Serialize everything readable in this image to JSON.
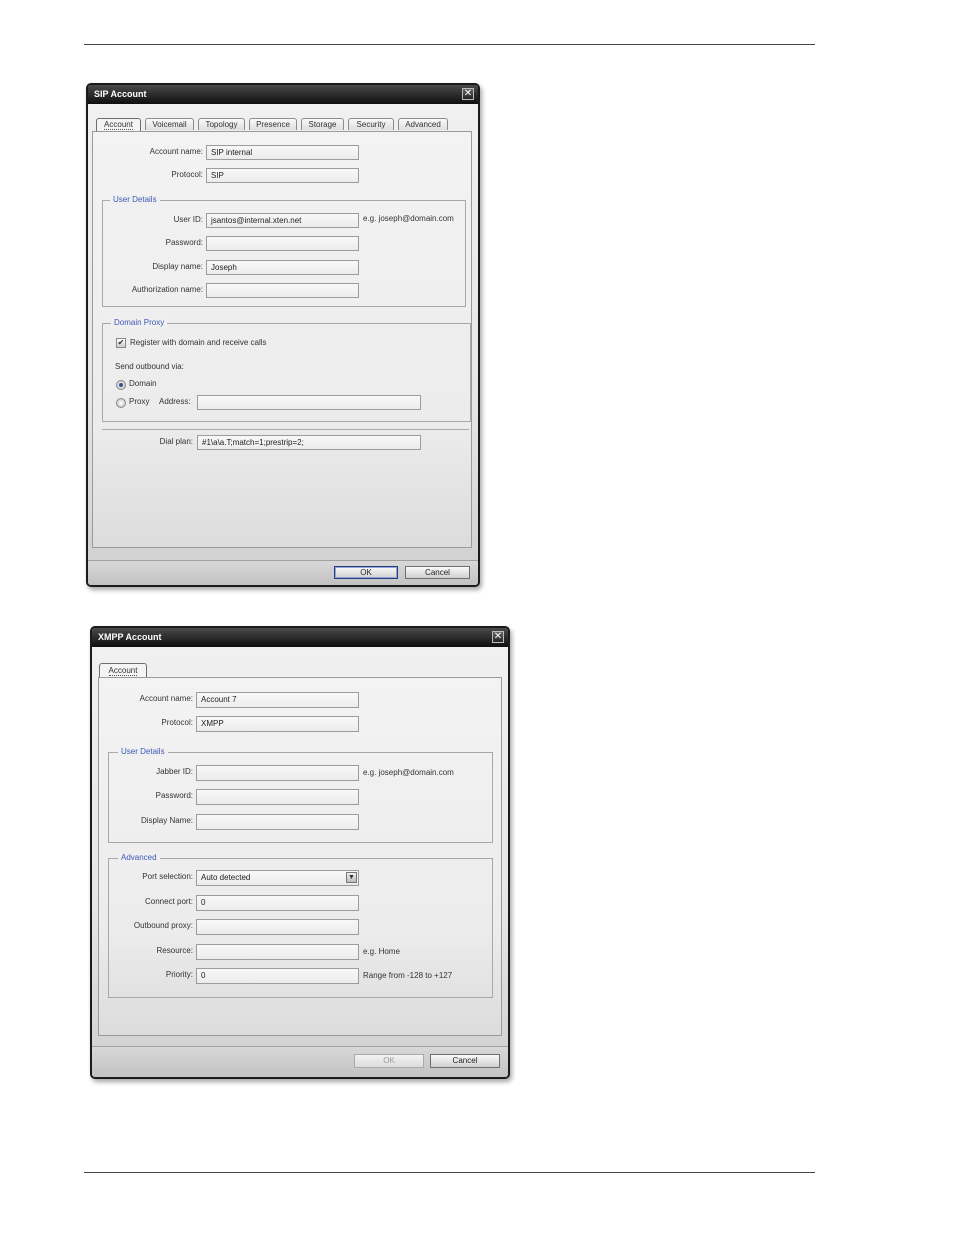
{
  "sip": {
    "title": "SIP Account",
    "close": "✕",
    "tabs": [
      "Account",
      "Voicemail",
      "Topology",
      "Presence",
      "Storage",
      "Security",
      "Advanced"
    ],
    "account_name_label": "Account name:",
    "account_name_value": "SIP internal",
    "protocol_label": "Protocol:",
    "protocol_value": "SIP",
    "user_details": {
      "legend": "User Details",
      "user_id_label": "User ID:",
      "user_id_value": "jsantos@internal.xten.net",
      "user_id_hint": "e.g. joseph@domain.com",
      "password_label": "Password:",
      "password_value": "",
      "display_name_label": "Display name:",
      "display_name_value": "Joseph",
      "auth_name_label": "Authorization name:",
      "auth_name_value": ""
    },
    "domain_proxy": {
      "legend": "Domain Proxy",
      "register_label": "Register with domain and receive calls",
      "register_checked": true,
      "send_via_label": "Send outbound via:",
      "domain_label": "Domain",
      "proxy_label": "Proxy",
      "address_label": "Address:",
      "address_value": ""
    },
    "dial_plan_label": "Dial plan:",
    "dial_plan_value": "#1\\a\\a.T;match=1;prestrip=2;",
    "ok": "OK",
    "cancel": "Cancel"
  },
  "xmpp": {
    "title": "XMPP Account",
    "close": "✕",
    "tabs": [
      "Account"
    ],
    "account_name_label": "Account name:",
    "account_name_value": "Account 7",
    "protocol_label": "Protocol:",
    "protocol_value": "XMPP",
    "user_details": {
      "legend": "User Details",
      "jabber_id_label": "Jabber ID:",
      "jabber_id_value": "",
      "jabber_id_hint": "e.g. joseph@domain.com",
      "password_label": "Password:",
      "password_value": "",
      "display_name_label": "Display Name:",
      "display_name_value": ""
    },
    "advanced": {
      "legend": "Advanced",
      "port_selection_label": "Port selection:",
      "port_selection_value": "Auto detected",
      "connect_port_label": "Connect port:",
      "connect_port_value": "0",
      "outbound_proxy_label": "Outbound proxy:",
      "outbound_proxy_value": "",
      "resource_label": "Resource:",
      "resource_value": "",
      "resource_hint": "e.g. Home",
      "priority_label": "Priority:",
      "priority_value": "0",
      "priority_hint": "Range from -128 to +127"
    },
    "ok": "OK",
    "cancel": "Cancel"
  }
}
